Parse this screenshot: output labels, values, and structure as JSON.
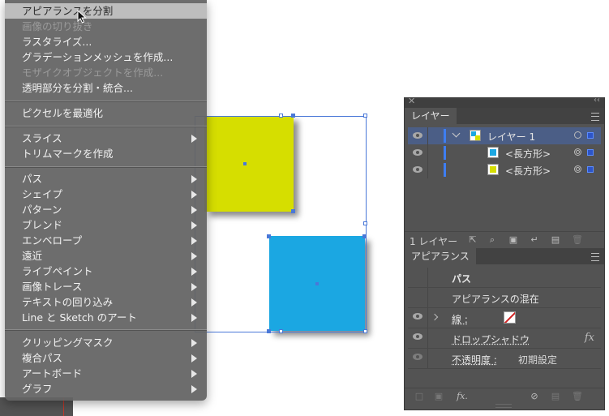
{
  "menu": {
    "items": [
      {
        "label": "アピアランスを分割",
        "state": "hover"
      },
      {
        "label": "画像の切り抜き",
        "state": "disabled"
      },
      {
        "label": "ラスタライズ...",
        "state": "normal"
      },
      {
        "label": "グラデーションメッシュを作成...",
        "state": "normal"
      },
      {
        "label": "モザイクオブジェクトを作成...",
        "state": "disabled"
      },
      {
        "label": "透明部分を分割・統合...",
        "state": "normal"
      },
      {
        "label": "ピクセルを最適化",
        "state": "normal"
      },
      {
        "label": "スライス",
        "state": "normal",
        "submenu": true
      },
      {
        "label": "トリムマークを作成",
        "state": "normal"
      },
      {
        "label": "パス",
        "state": "normal",
        "submenu": true
      },
      {
        "label": "シェイプ",
        "state": "normal",
        "submenu": true
      },
      {
        "label": "パターン",
        "state": "normal",
        "submenu": true
      },
      {
        "label": "ブレンド",
        "state": "normal",
        "submenu": true
      },
      {
        "label": "エンベロープ",
        "state": "normal",
        "submenu": true
      },
      {
        "label": "遠近",
        "state": "normal",
        "submenu": true
      },
      {
        "label": "ライブペイント",
        "state": "normal",
        "submenu": true
      },
      {
        "label": "画像トレース",
        "state": "normal",
        "submenu": true
      },
      {
        "label": "テキストの回り込み",
        "state": "normal",
        "submenu": true
      },
      {
        "label": "Line と Sketch のアート",
        "state": "normal",
        "submenu": true
      },
      {
        "label": "クリッピングマスク",
        "state": "normal",
        "submenu": true
      },
      {
        "label": "複合パス",
        "state": "normal",
        "submenu": true
      },
      {
        "label": "アートボード",
        "state": "normal",
        "submenu": true
      },
      {
        "label": "グラフ",
        "state": "normal",
        "submenu": true
      }
    ]
  },
  "layers_panel": {
    "tab": "レイヤー",
    "rows": [
      {
        "name": "レイヤー 1",
        "selected": true
      },
      {
        "name": "<長方形>",
        "swatch_color": "#1ba7e2"
      },
      {
        "name": "<長方形>",
        "swatch_color": "#d6de00"
      }
    ],
    "footer_count": "1 レイヤー"
  },
  "appearance_panel": {
    "tab": "アピアランス",
    "object_type": "パス",
    "blend": "アピアランスの混在",
    "stroke_label": "線 :",
    "effect_label": "ドロップシャドウ",
    "effect_fx": "fx",
    "opacity_label": "不透明度 :",
    "opacity_value": "初期設定",
    "footer_fx": "fx."
  },
  "artwork": {
    "yellow_fill": "#d6de00",
    "blue_fill": "#1ba7e2",
    "selection_color": "#4a78d8"
  }
}
